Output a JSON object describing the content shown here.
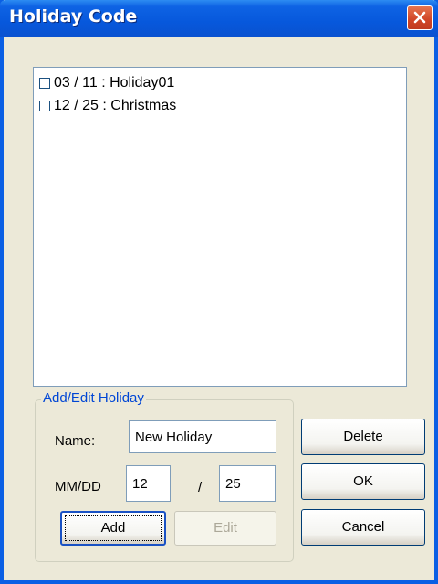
{
  "window": {
    "title": "Holiday Code",
    "accent": "#0a5fe4"
  },
  "holidays": [
    {
      "label": "03 / 11 : Holiday01",
      "checked": false
    },
    {
      "label": "12 / 25 : Christmas",
      "checked": false
    }
  ],
  "group": {
    "legend": "Add/Edit Holiday"
  },
  "form": {
    "name_label": "Name:",
    "name_value": "New Holiday",
    "date_label": "MM/DD",
    "month_value": "12",
    "separator": "/",
    "day_value": "25"
  },
  "buttons": {
    "add": "Add",
    "edit": "Edit",
    "delete": "Delete",
    "ok": "OK",
    "cancel": "Cancel"
  },
  "icons": {
    "close": "close-icon",
    "checkbox": "checkbox-icon"
  }
}
